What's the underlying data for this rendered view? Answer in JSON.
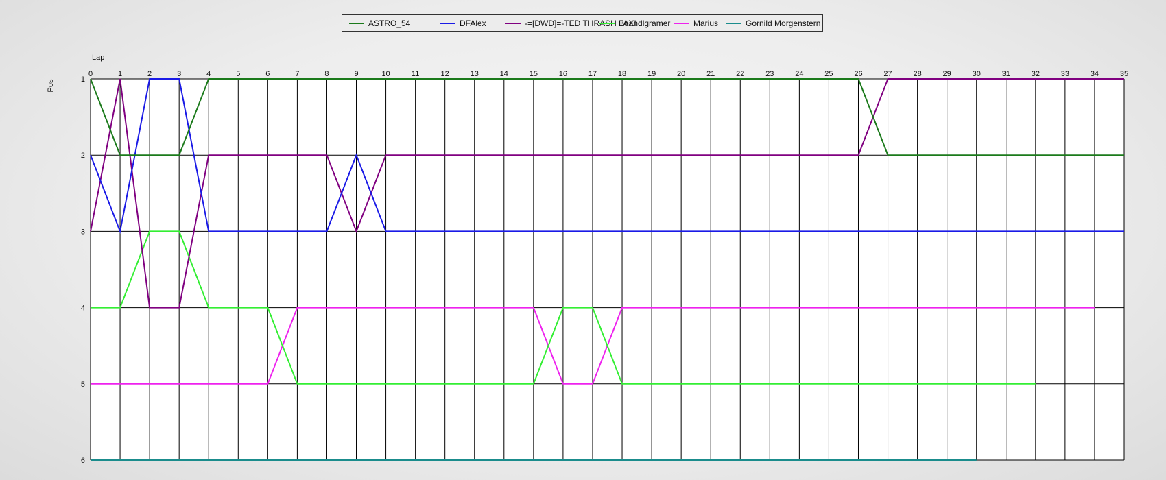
{
  "chart_data": {
    "type": "line",
    "xlabel": "Lap",
    "ylabel": "Pos",
    "xlim": [
      0,
      35
    ],
    "ylim": [
      1,
      6
    ],
    "y_inverted": true,
    "grid": true,
    "legend_position": "top-center",
    "x_ticks": [
      0,
      1,
      2,
      3,
      4,
      5,
      6,
      7,
      8,
      9,
      10,
      11,
      12,
      13,
      14,
      15,
      16,
      17,
      18,
      19,
      20,
      21,
      22,
      23,
      24,
      25,
      26,
      27,
      28,
      29,
      30,
      31,
      32,
      33,
      34,
      35
    ],
    "y_ticks": [
      1,
      2,
      3,
      4,
      5,
      6
    ],
    "series": [
      {
        "name": "ASTRO_54",
        "color": "#1b7a1b",
        "points": [
          [
            0,
            1
          ],
          [
            1,
            2
          ],
          [
            2,
            2
          ],
          [
            3,
            2
          ],
          [
            4,
            1
          ],
          [
            26,
            1
          ],
          [
            27,
            2
          ],
          [
            35,
            2
          ]
        ]
      },
      {
        "name": "DFAlex",
        "color": "#1a1ae6",
        "points": [
          [
            0,
            2
          ],
          [
            1,
            3
          ],
          [
            2,
            1
          ],
          [
            3,
            1
          ],
          [
            4,
            3
          ],
          [
            8,
            3
          ],
          [
            9,
            2
          ],
          [
            10,
            3
          ],
          [
            35,
            3
          ]
        ]
      },
      {
        "name": "-=[DWD]=-TED THRASH TAXI",
        "color": "#800080",
        "points": [
          [
            0,
            3
          ],
          [
            1,
            1
          ],
          [
            2,
            4
          ],
          [
            3,
            4
          ],
          [
            4,
            2
          ],
          [
            8,
            2
          ],
          [
            9,
            3
          ],
          [
            10,
            2
          ],
          [
            26,
            2
          ],
          [
            27,
            1
          ],
          [
            35,
            1
          ]
        ]
      },
      {
        "name": "Boandlgramer",
        "color": "#33ee33",
        "points": [
          [
            0,
            4
          ],
          [
            1,
            4
          ],
          [
            2,
            3
          ],
          [
            3,
            3
          ],
          [
            4,
            4
          ],
          [
            6,
            4
          ],
          [
            7,
            5
          ],
          [
            15,
            5
          ],
          [
            16,
            4
          ],
          [
            17,
            4
          ],
          [
            18,
            5
          ],
          [
            32,
            5
          ]
        ]
      },
      {
        "name": "Marius",
        "color": "#ee22ee",
        "points": [
          [
            0,
            5
          ],
          [
            6,
            5
          ],
          [
            7,
            4
          ],
          [
            15,
            4
          ],
          [
            16,
            5
          ],
          [
            17,
            5
          ],
          [
            18,
            4
          ],
          [
            34,
            4
          ]
        ]
      },
      {
        "name": "Gornild Morgenstern",
        "color": "#1a8c8c",
        "points": [
          [
            0,
            6
          ],
          [
            30,
            6
          ]
        ]
      }
    ]
  }
}
